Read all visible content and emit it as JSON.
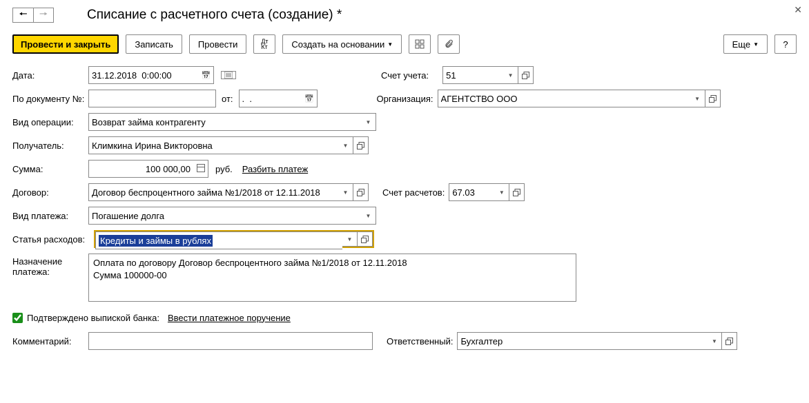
{
  "title": "Списание с расчетного счета (создание) *",
  "toolbar": {
    "post_close": "Провести и закрыть",
    "save": "Записать",
    "post": "Провести",
    "create_based": "Создать на основании",
    "more": "Еще",
    "help": "?"
  },
  "labels": {
    "date": "Дата:",
    "docnum": "По документу №:",
    "docnum_from": "от:",
    "optype": "Вид операции:",
    "recipient": "Получатель:",
    "sum": "Сумма:",
    "currency": "руб.",
    "split": "Разбить платеж",
    "contract": "Договор:",
    "paytype": "Вид платежа:",
    "expense": "Статья расходов:",
    "purpose": "Назначение платежа:",
    "confirmed": "Подтверждено выпиской банка:",
    "enter_pp": "Ввести платежное поручение",
    "comment": "Комментарий:",
    "account": "Счет учета:",
    "org": "Организация:",
    "settle_acct": "Счет расчетов:",
    "responsible": "Ответственный:"
  },
  "values": {
    "date": "31.12.2018  0:00:00",
    "docnum": "",
    "docdate": ".  .",
    "optype": "Возврат займа контрагенту",
    "recipient": "Климкина Ирина Викторовна",
    "sum": "100 000,00",
    "contract": "Договор беспроцентного займа №1/2018 от 12.11.2018",
    "paytype": "Погашение долга",
    "expense": "Кредиты и займы в рублях",
    "purpose": "Оплата по договору Договор беспроцентного займа №1/2018 от 12.11.2018\nСумма 100000-00",
    "comment": "",
    "account": "51",
    "org": "АГЕНТСТВО ООО",
    "settle_acct": "67.03",
    "responsible": "Бухгалтер"
  }
}
